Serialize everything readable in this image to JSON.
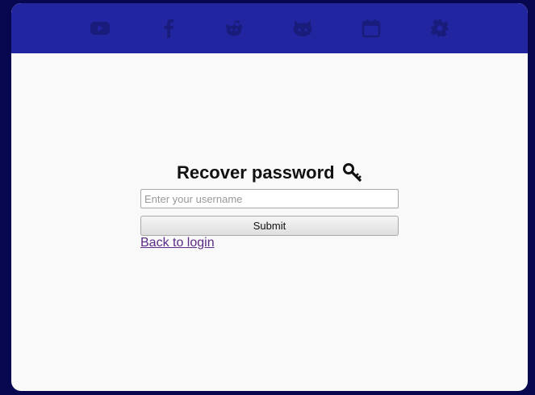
{
  "topbar": {
    "icons": [
      "youtube-icon",
      "facebook-icon",
      "reddit-icon",
      "github-icon",
      "calendar-icon",
      "settings-icon"
    ]
  },
  "form": {
    "title": "Recover password",
    "title_icon": "key-icon",
    "username_placeholder": "Enter your username",
    "username_value": "",
    "submit_label": "Submit",
    "back_link_label": "Back to login"
  },
  "colors": {
    "page_background": "#07074f",
    "topbar": "#2225a0",
    "topbar_icons": "#1a1c7c",
    "content_background": "#f9f9f9",
    "link": "#5b2a86"
  }
}
